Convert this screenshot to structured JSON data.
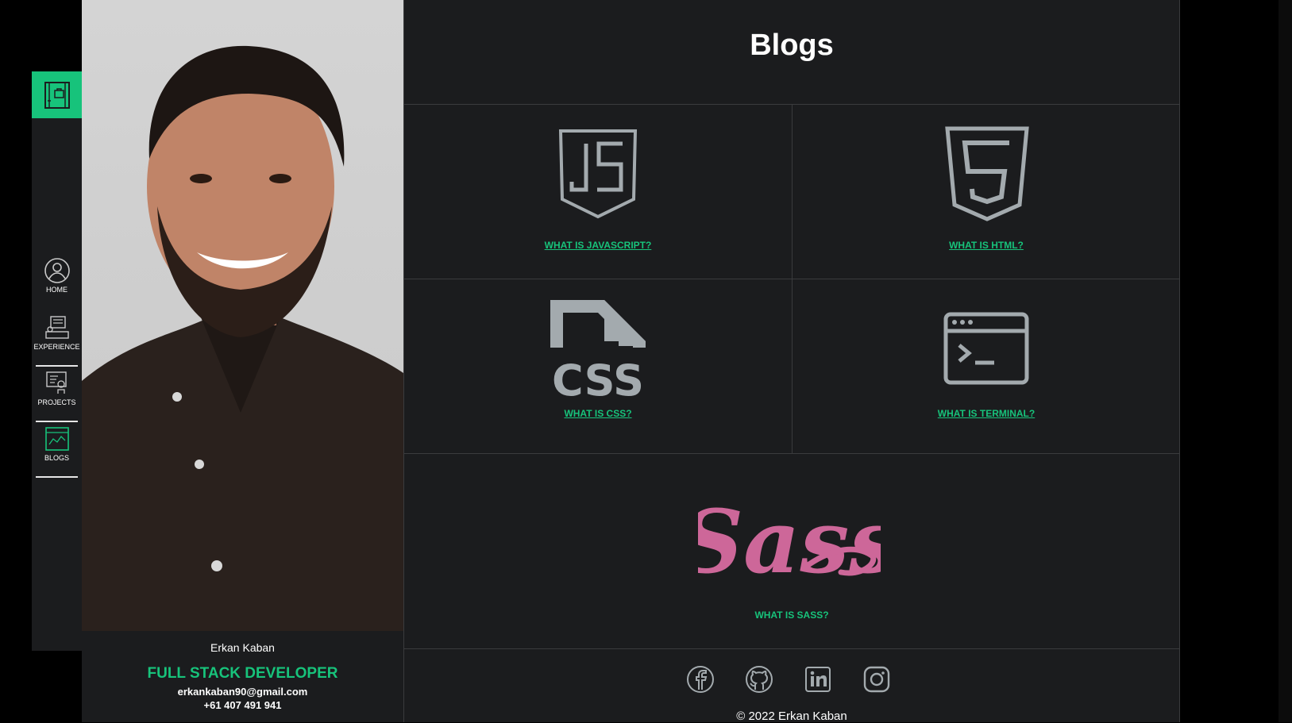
{
  "sidebar": {
    "items": [
      {
        "label": "HOME",
        "icon": "user-circle-icon"
      },
      {
        "label": "EXPERIENCE",
        "icon": "experience-icon"
      },
      {
        "label": "PROJECTS",
        "icon": "projects-icon"
      },
      {
        "label": "BLOGS",
        "icon": "blogs-icon"
      }
    ]
  },
  "profile": {
    "name": "Erkan Kaban",
    "role": "FULL STACK DEVELOPER",
    "email": "erkankaban90@gmail.com",
    "phone": "+61 407 491 941"
  },
  "main": {
    "title": "Blogs",
    "cards": [
      {
        "label": "WHAT IS JAVASCRIPT?",
        "icon": "javascript-icon"
      },
      {
        "label": "WHAT IS HTML?",
        "icon": "html5-icon"
      },
      {
        "label": "WHAT IS CSS?",
        "icon": "css-file-icon"
      },
      {
        "label": "WHAT IS TERMINAL?",
        "icon": "terminal-icon"
      }
    ],
    "sass": {
      "label": "WHAT IS SASS?",
      "logo_text": "Sass"
    }
  },
  "footer": {
    "socials": [
      "facebook-icon",
      "github-icon",
      "linkedin-icon",
      "instagram-icon"
    ],
    "copyright": "© 2022 Erkan Kaban"
  },
  "colors": {
    "accent": "#17c37b",
    "background": "#1b1c1e",
    "icon_gray": "#a3aaae",
    "sass_pink": "#cd6799"
  }
}
